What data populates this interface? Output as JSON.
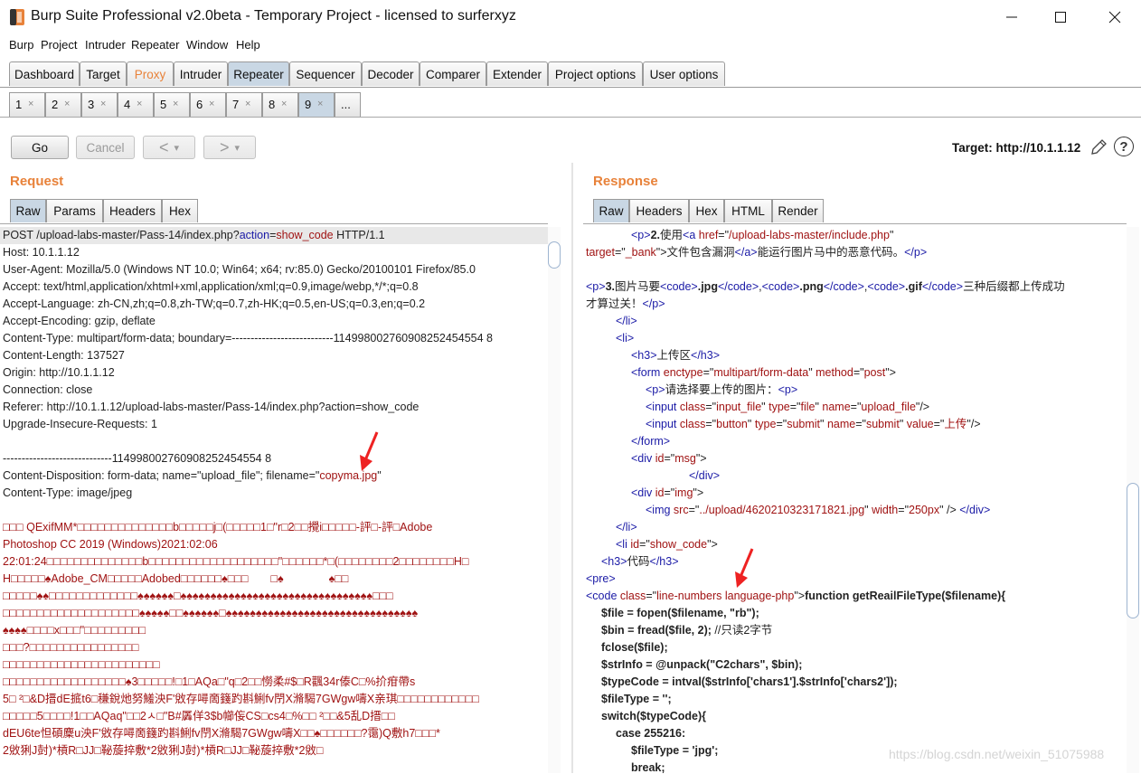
{
  "window": {
    "title": "Burp Suite Professional v2.0beta - Temporary Project - licensed to surferxyz",
    "minimize": "—",
    "maximize": "☐",
    "close": "✕"
  },
  "menu": [
    "Burp",
    "Project",
    "Intruder",
    "Repeater",
    "Window",
    "Help"
  ],
  "main_tabs": [
    "Dashboard",
    "Target",
    "Proxy",
    "Intruder",
    "Repeater",
    "Sequencer",
    "Decoder",
    "Comparer",
    "Extender",
    "Project options",
    "User options"
  ],
  "active_main_tab": "Repeater",
  "repeater_tabs": [
    "1",
    "2",
    "3",
    "4",
    "5",
    "6",
    "7",
    "8",
    "9"
  ],
  "repeater_tab_close": "×",
  "repeater_more": "...",
  "active_repeater_tab": "9",
  "toolbar": {
    "go": "Go",
    "cancel": "Cancel",
    "back": "<",
    "forward": ">",
    "dropdown": "▾",
    "target": "Target: http://10.1.1.12",
    "help": "?"
  },
  "request": {
    "title": "Request",
    "tabs": [
      "Raw",
      "Params",
      "Headers",
      "Hex"
    ],
    "active_tab": "Raw",
    "lines": [
      [
        {
          "t": "POST /upload-labs-master/Pass-14/index.php?"
        },
        {
          "t": "action",
          "c": "blue"
        },
        {
          "t": "="
        },
        {
          "t": "show_code",
          "c": "red"
        },
        {
          "t": " HTTP/1.1"
        }
      ],
      [
        {
          "t": "Host: 10.1.1.12"
        }
      ],
      [
        {
          "t": "User-Agent: Mozilla/5.0 (Windows NT 10.0; Win64; x64; rv:85.0) Gecko/20100101 Firefox/85.0"
        }
      ],
      [
        {
          "t": "Accept: text/html,application/xhtml+xml,application/xml;q=0.9,image/webp,*/*;q=0.8"
        }
      ],
      [
        {
          "t": "Accept-Language: zh-CN,zh;q=0.8,zh-TW;q=0.7,zh-HK;q=0.5,en-US;q=0.3,en;q=0.2"
        }
      ],
      [
        {
          "t": "Accept-Encoding: gzip, deflate"
        }
      ],
      [
        {
          "t": "Content-Type: multipart/form-data; boundary=---------------------------114998002760908252454554 8"
        }
      ],
      [
        {
          "t": "Content-Length: 137527"
        }
      ],
      [
        {
          "t": "Origin: http://10.1.1.12"
        }
      ],
      [
        {
          "t": "Connection: close"
        }
      ],
      [
        {
          "t": "Referer: http://10.1.1.12/upload-labs-master/Pass-14/index.php?action=show_code"
        }
      ],
      [
        {
          "t": "Upgrade-Insecure-Requests: 1"
        }
      ],
      [
        {
          "t": ""
        }
      ],
      [
        {
          "t": "-----------------------------114998002760908252454554 8"
        }
      ],
      [
        {
          "t": "Content-Disposition: form-data; name=\"upload_file\"; filename=\""
        },
        {
          "t": "copyma.jpg",
          "c": "red"
        },
        {
          "t": "\""
        }
      ],
      [
        {
          "t": "Content-Type: image/jpeg"
        }
      ],
      [
        {
          "t": ""
        }
      ],
      [
        {
          "t": "□□□ QExifMM*□□□□□□□□□□□□□□b□□□□□j□(□□□□□1□\"r□2□□攪i□□□□□-評□-評□Adobe",
          "c": "red"
        }
      ],
      [
        {
          "t": "Photoshop CC 2019 (Windows)2021:02:06",
          "c": "red"
        }
      ],
      [
        {
          "t": "22:01:24□□□□□□□□□□□□□□b□□□□□□□□□□□□□□□□□□□\"□□□□□□*□(□□□□□□□□2□□□□□□□□H□",
          "c": "red"
        }
      ],
      [
        {
          "t": "H□□□□□♠Adobe_CM□□□□□Adobed□□□□□□♠□□□　　□♠　　　　♠□□",
          "c": "red"
        }
      ],
      [
        {
          "t": "□□□□□♠♠□□□□□□□□□□□□□♠♠♠♠♠♠□♠♠♠♠♠♠♠♠♠♠♠♠♠♠♠♠♠♠♠♠♠♠♠♠♠♠♠♠♠♠♠♠□□□",
          "c": "red"
        }
      ],
      [
        {
          "t": "□□□□□□□□□□□□□□□□□□□□♠♠♠♠♠□□♠♠♠♠♠♠□♠♠♠♠♠♠♠♠♠♠♠♠♠♠♠♠♠♠♠♠♠♠♠♠♠♠♠♠♠♠♠♠",
          "c": "red"
        }
      ],
      [
        {
          "t": "♠♠♠♠□□□□x□□□\"□□□□□□□□□",
          "c": "red"
        }
      ],
      [
        {
          "t": "□□□?□□□□□□□□□□□□□□□□",
          "c": "red"
        }
      ],
      [
        {
          "t": "□□□□□□□□□□□□□□□□□□□□□□□",
          "c": "red"
        }
      ],
      [
        {
          "t": "□□□□□□□□□□□□□□□□□□♠3□□□□□!□1□AQa□\"q□2□□憦柔#$□R飌34r傣C□%扴疳帶s",
          "c": "red"
        }
      ],
      [
        {
          "t": "5□ ²□&D搢dE掋t6□稴銳灺努鱃泱F'敓存噚啇籛趵斟鯏fv閅X滫騔7GWgw嚋X亲琪□□□□□□□□□□□□",
          "c": "red"
        }
      ],
      [
        {
          "t": "□□□□□5□□□□!1□□AQaq\"□□2ㅅ□\"B#羼佯3$b幯侫CS□cs4□%□□ ²□□&5乱D搢□□",
          "c": "red"
        }
      ],
      [
        {
          "t": "dEU6te怛碩麇u泱F'敓存噚啇籛趵斟鯏fv閅X滫騔7GWgw嚋X□□♠□□□□□□?霭)Q敷h7□□□*",
          "c": "red"
        }
      ],
      [
        {
          "t": "2敓猁J尌)*槓R□JJ□䩛蔙捽敷*2敓猁J尌)*槓R□JJ□䩛蔙捽敷*2敓□",
          "c": "red"
        }
      ]
    ]
  },
  "response": {
    "title": "Response",
    "tabs": [
      "Raw",
      "Headers",
      "Hex",
      "HTML",
      "Render"
    ],
    "active_tab": "Raw",
    "lines": [
      {
        "i": 50,
        "s": [
          {
            "t": "<p>",
            "c": "blue"
          },
          {
            "t": "2.",
            "c": "b"
          },
          {
            "t": "使用"
          },
          {
            "t": "<a ",
            "c": "blue"
          },
          {
            "t": "href",
            "c": "red"
          },
          {
            "t": "=\""
          },
          {
            "t": "/upload-labs-master/include.php",
            "c": "red"
          },
          {
            "t": "\""
          }
        ]
      },
      {
        "i": 0,
        "s": [
          {
            "t": "target",
            "c": "red"
          },
          {
            "t": "=\""
          },
          {
            "t": "_bank",
            "c": "red"
          },
          {
            "t": "\">"
          },
          {
            "t": "文件包含漏洞"
          },
          {
            "t": "</a>",
            "c": "blue"
          },
          {
            "t": "能运行图片马中的恶意代码。"
          },
          {
            "t": "</p>",
            "c": "blue"
          }
        ]
      },
      {
        "i": 0,
        "s": [
          {
            "t": ""
          }
        ]
      },
      {
        "i": 0,
        "s": [
          {
            "t": "<p>",
            "c": "blue"
          },
          {
            "t": "3.",
            "c": "b"
          },
          {
            "t": "图片马要"
          },
          {
            "t": "<code>",
            "c": "blue"
          },
          {
            "t": ".jpg",
            "c": "b"
          },
          {
            "t": "</code>",
            "c": "blue"
          },
          {
            "t": ","
          },
          {
            "t": "<code>",
            "c": "blue"
          },
          {
            "t": ".png",
            "c": "b"
          },
          {
            "t": "</code>",
            "c": "blue"
          },
          {
            "t": ","
          },
          {
            "t": "<code>",
            "c": "blue"
          },
          {
            "t": ".gif",
            "c": "b"
          },
          {
            "t": "</code>",
            "c": "blue"
          },
          {
            "t": "三种后缀都上传成功"
          }
        ]
      },
      {
        "i": 0,
        "s": [
          {
            "t": "才算过关！"
          },
          {
            "t": "</p>",
            "c": "blue"
          }
        ]
      },
      {
        "i": 33,
        "s": [
          {
            "t": "</li>",
            "c": "blue"
          }
        ]
      },
      {
        "i": 33,
        "s": [
          {
            "t": "<li>",
            "c": "blue"
          }
        ]
      },
      {
        "i": 50,
        "s": [
          {
            "t": "<h3>",
            "c": "blue"
          },
          {
            "t": "上传区"
          },
          {
            "t": "</h3>",
            "c": "blue"
          }
        ]
      },
      {
        "i": 50,
        "s": [
          {
            "t": "<form ",
            "c": "blue"
          },
          {
            "t": "enctype",
            "c": "red"
          },
          {
            "t": "=\""
          },
          {
            "t": "multipart/form-data",
            "c": "red"
          },
          {
            "t": "\" "
          },
          {
            "t": "method",
            "c": "red"
          },
          {
            "t": "=\""
          },
          {
            "t": "post",
            "c": "red"
          },
          {
            "t": "\">"
          }
        ]
      },
      {
        "i": 66,
        "s": [
          {
            "t": "<p>",
            "c": "blue"
          },
          {
            "t": "请选择要上传的图片："
          },
          {
            "t": "<p>",
            "c": "blue"
          }
        ]
      },
      {
        "i": 66,
        "s": [
          {
            "t": "<input ",
            "c": "blue"
          },
          {
            "t": "class",
            "c": "red"
          },
          {
            "t": "=\""
          },
          {
            "t": "input_file",
            "c": "red"
          },
          {
            "t": "\" "
          },
          {
            "t": "type",
            "c": "red"
          },
          {
            "t": "=\""
          },
          {
            "t": "file",
            "c": "red"
          },
          {
            "t": "\" "
          },
          {
            "t": "name",
            "c": "red"
          },
          {
            "t": "=\""
          },
          {
            "t": "upload_file",
            "c": "red"
          },
          {
            "t": "\"/>"
          }
        ]
      },
      {
        "i": 66,
        "s": [
          {
            "t": "<input ",
            "c": "blue"
          },
          {
            "t": "class",
            "c": "red"
          },
          {
            "t": "=\""
          },
          {
            "t": "button",
            "c": "red"
          },
          {
            "t": "\" "
          },
          {
            "t": "type",
            "c": "red"
          },
          {
            "t": "=\""
          },
          {
            "t": "submit",
            "c": "red"
          },
          {
            "t": "\" "
          },
          {
            "t": "name",
            "c": "red"
          },
          {
            "t": "=\""
          },
          {
            "t": "submit",
            "c": "red"
          },
          {
            "t": "\" "
          },
          {
            "t": "value",
            "c": "red"
          },
          {
            "t": "=\""
          },
          {
            "t": "上传",
            "c": "red"
          },
          {
            "t": "\"/>"
          }
        ]
      },
      {
        "i": 50,
        "s": [
          {
            "t": "</form>",
            "c": "blue"
          }
        ]
      },
      {
        "i": 50,
        "s": [
          {
            "t": "<div ",
            "c": "blue"
          },
          {
            "t": "id",
            "c": "red"
          },
          {
            "t": "=\""
          },
          {
            "t": "msg",
            "c": "red"
          },
          {
            "t": "\">"
          }
        ]
      },
      {
        "i": 114,
        "s": [
          {
            "t": "</div>",
            "c": "blue"
          }
        ]
      },
      {
        "i": 50,
        "s": [
          {
            "t": "<div ",
            "c": "blue"
          },
          {
            "t": "id",
            "c": "red"
          },
          {
            "t": "=\""
          },
          {
            "t": "img",
            "c": "red"
          },
          {
            "t": "\">"
          }
        ]
      },
      {
        "i": 66,
        "s": [
          {
            "t": "<img ",
            "c": "blue"
          },
          {
            "t": "src",
            "c": "red"
          },
          {
            "t": "=\""
          },
          {
            "t": "../upload/4620210323171821.jpg",
            "c": "red"
          },
          {
            "t": "\" "
          },
          {
            "t": "width",
            "c": "red"
          },
          {
            "t": "=\""
          },
          {
            "t": "250px",
            "c": "red"
          },
          {
            "t": "\" />            "
          },
          {
            "t": "</div>",
            "c": "blue"
          }
        ]
      },
      {
        "i": 33,
        "s": [
          {
            "t": "</li>",
            "c": "blue"
          }
        ]
      },
      {
        "i": 33,
        "s": [
          {
            "t": "<li ",
            "c": "blue"
          },
          {
            "t": "id",
            "c": "red"
          },
          {
            "t": "=\""
          },
          {
            "t": "show_code",
            "c": "red"
          },
          {
            "t": "\">"
          }
        ]
      },
      {
        "i": 17,
        "s": [
          {
            "t": "<h3>",
            "c": "blue"
          },
          {
            "t": "代码"
          },
          {
            "t": "</h3>",
            "c": "blue"
          }
        ]
      },
      {
        "i": 0,
        "s": [
          {
            "t": "<pre>",
            "c": "blue"
          }
        ]
      },
      {
        "i": 0,
        "s": [
          {
            "t": "<code ",
            "c": "blue"
          },
          {
            "t": "class",
            "c": "red"
          },
          {
            "t": "=\""
          },
          {
            "t": "line-numbers language-php",
            "c": "red"
          },
          {
            "t": "\">"
          },
          {
            "t": "function getReailFileType($filename){",
            "c": "b"
          }
        ]
      },
      {
        "i": 17,
        "s": [
          {
            "t": "$file = fopen($filename, \"rb\");",
            "c": "b"
          }
        ]
      },
      {
        "i": 17,
        "s": [
          {
            "t": "$bin = fread($file, 2); ",
            "c": "b"
          },
          {
            "t": "//只读2字节"
          }
        ]
      },
      {
        "i": 17,
        "s": [
          {
            "t": "fclose($file);",
            "c": "b"
          }
        ]
      },
      {
        "i": 17,
        "s": [
          {
            "t": "$strInfo = @unpack(\"C2chars\", $bin);",
            "c": "b"
          }
        ]
      },
      {
        "i": 17,
        "s": [
          {
            "t": "$typeCode = intval($strInfo['chars1'].$strInfo['chars2']);",
            "c": "b"
          }
        ]
      },
      {
        "i": 17,
        "s": [
          {
            "t": "$fileType = '';",
            "c": "b"
          }
        ]
      },
      {
        "i": 17,
        "s": [
          {
            "t": "switch($typeCode){",
            "c": "b"
          }
        ]
      },
      {
        "i": 33,
        "s": [
          {
            "t": "case 255216:",
            "c": "b"
          }
        ]
      },
      {
        "i": 50,
        "s": [
          {
            "t": "$fileType = 'jpg';",
            "c": "b"
          }
        ]
      },
      {
        "i": 50,
        "s": [
          {
            "t": "break;",
            "c": "b"
          }
        ]
      }
    ]
  },
  "watermark": "https://blog.csdn.net/weixin_51075988",
  "colors": {
    "accent_orange": "#e8823a",
    "selected_tab": "#c9d7e4",
    "code_red": "#a01313",
    "code_blue": "#1a1aa6"
  }
}
